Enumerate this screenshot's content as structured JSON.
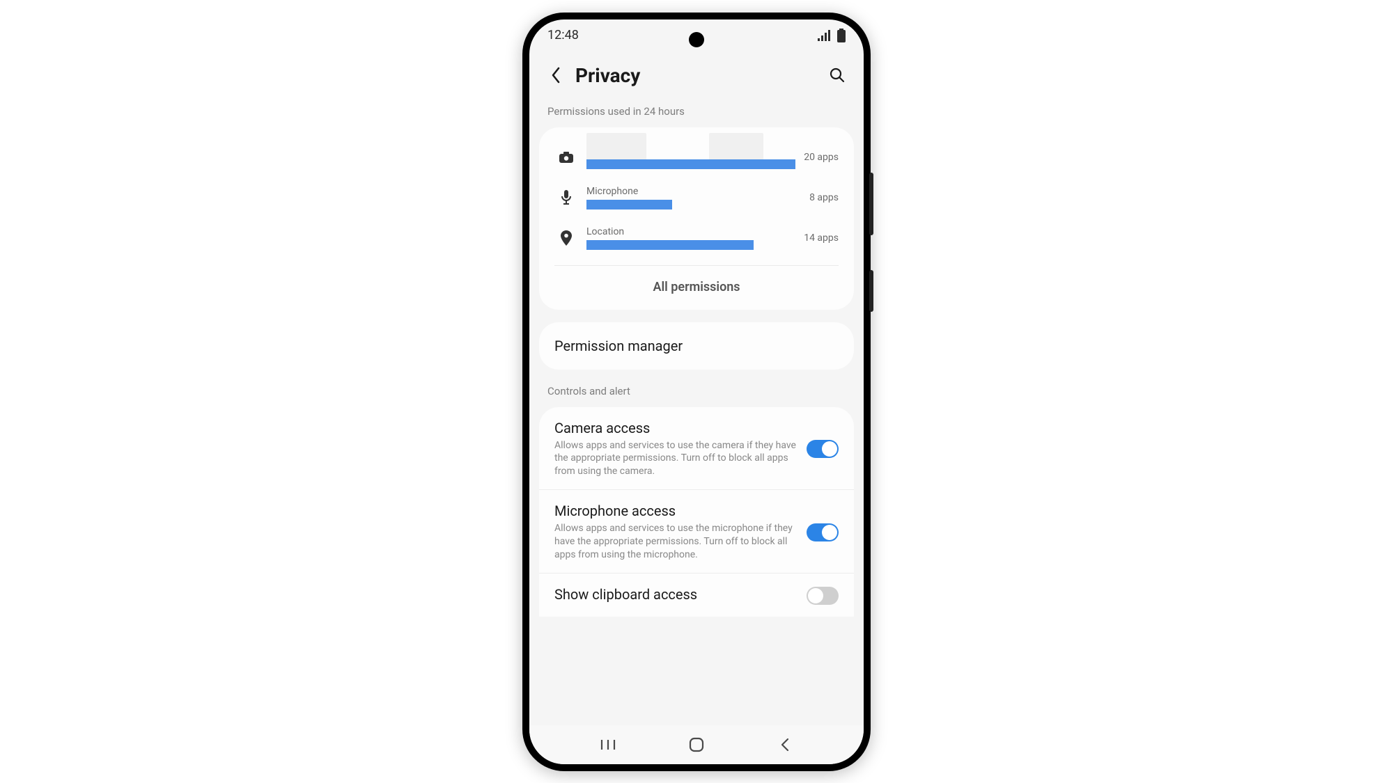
{
  "statusbar": {
    "time": "12:48"
  },
  "header": {
    "title": "Privacy"
  },
  "dashboard": {
    "label": "Permissions used in 24 hours",
    "items": [
      {
        "name": "Camera",
        "count": "20 apps",
        "bar_pct": 100,
        "icon": "camera"
      },
      {
        "name": "Microphone",
        "count": "8 apps",
        "bar_pct": 40,
        "icon": "microphone"
      },
      {
        "name": "Location",
        "count": "14 apps",
        "bar_pct": 80,
        "icon": "location"
      }
    ],
    "all_permissions_label": "All permissions"
  },
  "permission_manager": {
    "title": "Permission manager"
  },
  "controls": {
    "label": "Controls and alert",
    "items": [
      {
        "title": "Camera access",
        "desc": "Allows apps and services to use the camera if they have the appropriate permissions. Turn off to block all apps from using the camera.",
        "on": true
      },
      {
        "title": "Microphone access",
        "desc": "Allows apps and services to use the microphone if they have the appropriate permissions. Turn off to block all apps from using the microphone.",
        "on": true
      },
      {
        "title": "Show clipboard access",
        "desc": "",
        "on": false
      }
    ]
  },
  "colors": {
    "accent": "#2b84e6",
    "bar": "#4a8fe7"
  }
}
